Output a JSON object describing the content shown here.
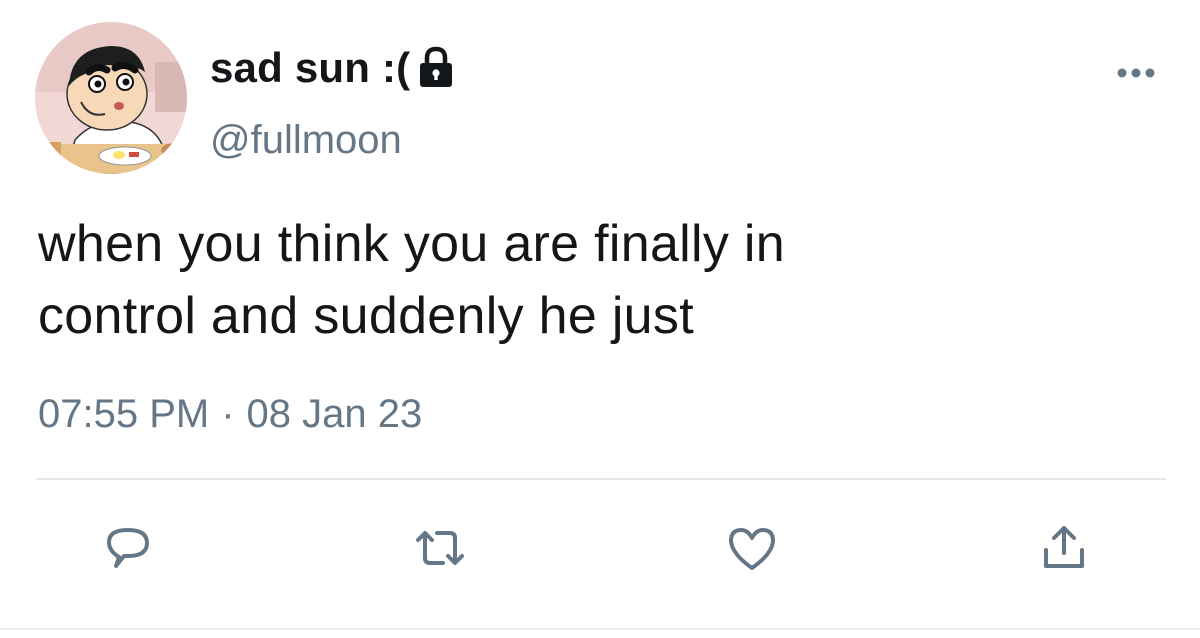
{
  "author": {
    "display_name": "sad sun :(",
    "handle": "@fullmoon",
    "protected": true
  },
  "tweet": {
    "text_line1": "when you think you are finally in",
    "text_line2": "control and suddenly he just",
    "time": "07:55 PM",
    "separator": "·",
    "date": "08 Jan 23"
  },
  "icons": {
    "lock": "lock-icon",
    "more": "more-icon",
    "reply": "reply-icon",
    "retweet": "retweet-icon",
    "like": "heart-icon",
    "share": "share-icon"
  },
  "colors": {
    "text": "#14171a",
    "secondary": "#657786",
    "action_icon": "#657786",
    "divider": "#e1e8ed"
  }
}
